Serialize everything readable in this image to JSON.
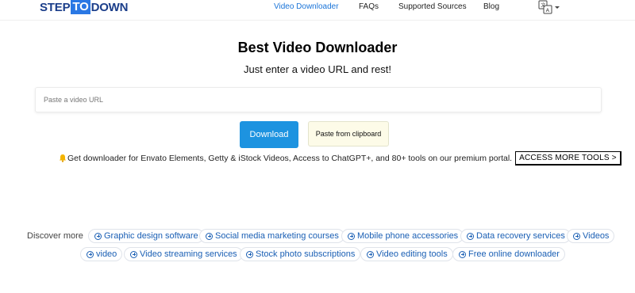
{
  "header": {
    "logo": {
      "part1": "STEP",
      "part2": "TO",
      "part3": "DOWN"
    },
    "nav": [
      {
        "label": "Video Downloader",
        "active": true
      },
      {
        "label": "FAQs",
        "active": false
      },
      {
        "label": "Supported Sources",
        "active": false
      },
      {
        "label": "Blog",
        "active": false
      }
    ],
    "language_icon": "translate-icon"
  },
  "hero": {
    "title": "Best Video Downloader",
    "subtitle": "Just enter a video URL and rest!"
  },
  "url_input": {
    "placeholder": "Paste a video URL",
    "value": ""
  },
  "buttons": {
    "download": "Download",
    "paste": "Paste from clipboard"
  },
  "promo": {
    "icon": "bell-icon",
    "text": "Get downloader for Envato Elements, Getty & iStock Videos, Access to ChatGPT+, and 80+ tools on our premium portal.",
    "button": "ACCESS MORE TOOLS >"
  },
  "discover": {
    "label": "Discover more",
    "chips": [
      "Graphic design software",
      "Social media marketing courses",
      "Mobile phone accessories",
      "Data recovery services",
      "Videos",
      "video",
      "Video streaming services",
      "Stock photo subscriptions",
      "Video editing tools",
      "Free online downloader"
    ]
  },
  "colors": {
    "accent": "#1d93e0",
    "nav_active": "#1a74d8",
    "logo_blue": "#1b3e8a",
    "paste_bg": "#fdfbe8",
    "chip_text": "#1a5fb4"
  }
}
